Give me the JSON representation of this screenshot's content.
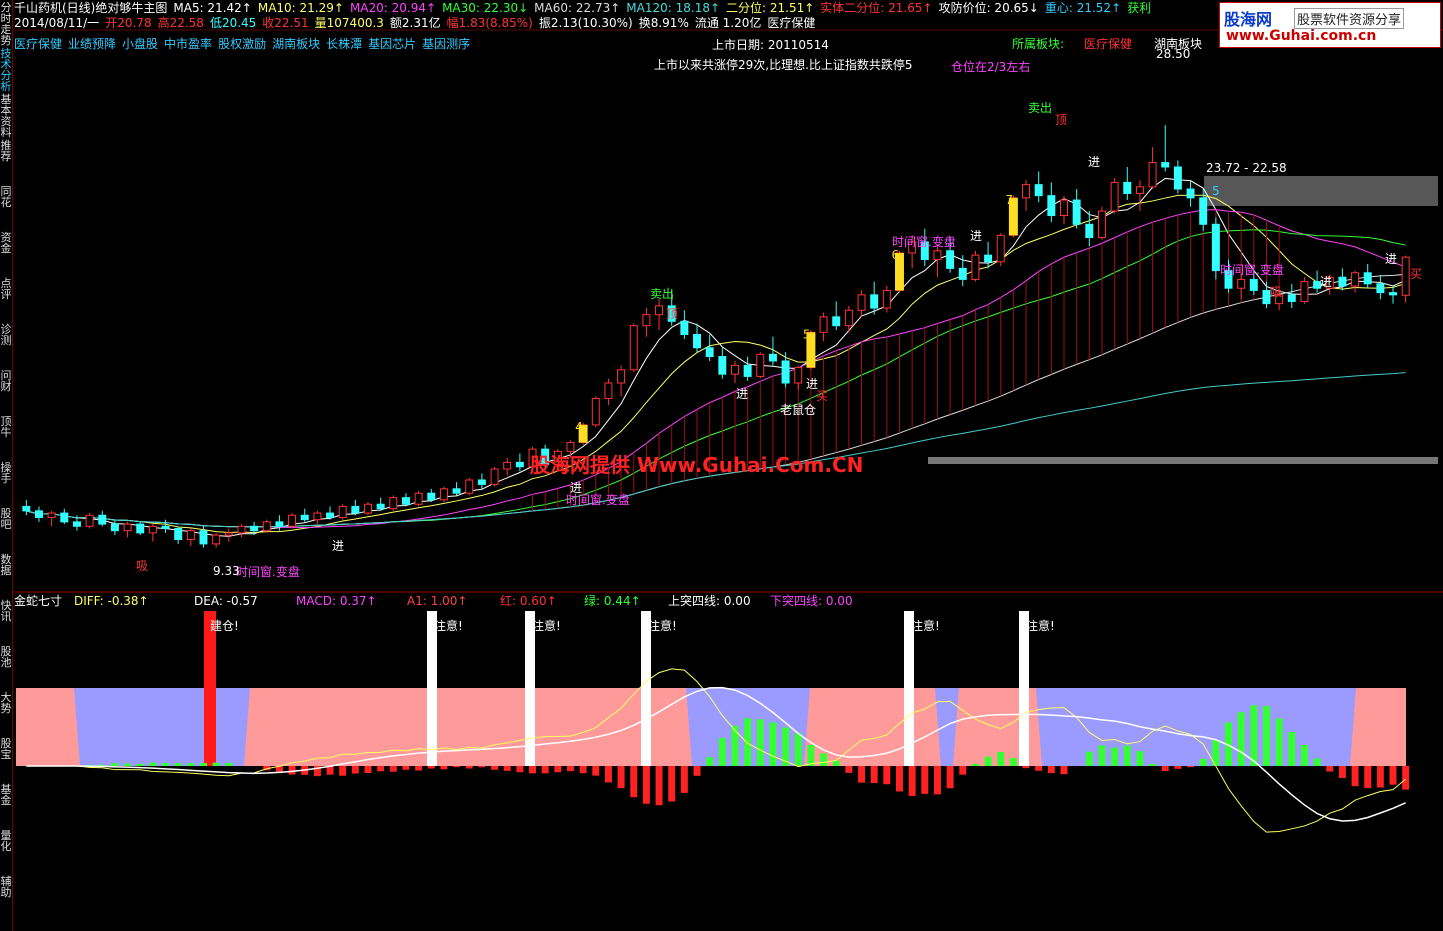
{
  "header": {
    "row1": [
      {
        "t": "千山药机(日线)绝对够牛主图",
        "c": "#ffffff"
      },
      {
        "t": "MA5: 21.42↑",
        "c": "#ffffff"
      },
      {
        "t": "MA10: 21.29↑",
        "c": "#ffff66"
      },
      {
        "t": "MA20: 20.94↑",
        "c": "#ff44ff"
      },
      {
        "t": "MA30: 22.30↓",
        "c": "#33ff33"
      },
      {
        "t": "MA60: 22.73↑",
        "c": "#dddddd"
      },
      {
        "t": "MA120: 18.18↑",
        "c": "#44dddd"
      },
      {
        "t": "二分位: 21.51↑",
        "c": "#ffff66"
      },
      {
        "t": "实体二分位: 21.65↑",
        "c": "#ff3333"
      },
      {
        "t": "攻防价位: 20.65↓",
        "c": "#ffffff"
      },
      {
        "t": "重心: 21.52↑",
        "c": "#33ccff"
      },
      {
        "t": "获利",
        "c": "#33ff33"
      }
    ],
    "row2": [
      {
        "t": "2014/08/11/一",
        "c": "#ffffff"
      },
      {
        "t": "开20.78",
        "c": "#ff3333"
      },
      {
        "t": "高22.58",
        "c": "#ff3333"
      },
      {
        "t": "低20.45",
        "c": "#33ffff"
      },
      {
        "t": "收22.51",
        "c": "#ff3333"
      },
      {
        "t": "量107400.3",
        "c": "#ffff66"
      },
      {
        "t": "额2.31亿",
        "c": "#ffffff"
      },
      {
        "t": "幅1.83(8.85%)",
        "c": "#ff3333"
      },
      {
        "t": "振2.13(10.30%)",
        "c": "#ffffff"
      },
      {
        "t": "换8.91%",
        "c": "#ffffff"
      },
      {
        "t": "流通 1.20亿",
        "c": "#ffffff"
      },
      {
        "t": "医疗保健",
        "c": "#ffffff"
      }
    ],
    "row3": [
      {
        "t": "医疗保健",
        "c": "#33ccff"
      },
      {
        "t": "业绩预降",
        "c": "#33ccff"
      },
      {
        "t": "小盘股",
        "c": "#33ccff"
      },
      {
        "t": "中市盈率",
        "c": "#33ccff"
      },
      {
        "t": "股权激励",
        "c": "#33ccff"
      },
      {
        "t": "湖南板块",
        "c": "#33ccff"
      },
      {
        "t": "长株潭",
        "c": "#33ccff"
      },
      {
        "t": "基因芯片",
        "c": "#33ccff"
      },
      {
        "t": "基因测序",
        "c": "#33ccff"
      }
    ]
  },
  "sidebar": {
    "items": [
      "分时走势",
      "技术分析",
      "基本资料",
      "推荐",
      "同花",
      "资金",
      "点评",
      "诊测",
      "问财",
      "顶牛",
      "操手",
      "股吧",
      "数据",
      "快讯",
      "股池",
      "大势",
      "股宝",
      "基金",
      "量化",
      "辅助"
    ]
  },
  "logo": {
    "name": "股海网",
    "sub": "股票软件资源分享",
    "url": "www.Guhai.com.cn"
  },
  "annotations": {
    "listing_date": "上市日期: 20110514",
    "listing_summary": "上市以来共涨停29次,比理想.比上证指数共跌停5",
    "position_hint": "仓位在2/3左右",
    "sector_label": "所属板块:",
    "sector_value": "医疗保健",
    "sector_value2": "湖南板块",
    "peak": "28.50",
    "range": "23.72 - 22.58",
    "low": "9.33",
    "box_num": "5",
    "watermark": "股海网提供 Www.Guhai.Com.CN"
  },
  "chart_data": {
    "type": "candlestick",
    "n": 110,
    "ohlc": [
      [
        11.2,
        11.5,
        10.8,
        11.0
      ],
      [
        11.0,
        11.2,
        10.5,
        10.7
      ],
      [
        10.7,
        11.0,
        10.3,
        10.9
      ],
      [
        10.9,
        11.1,
        10.4,
        10.5
      ],
      [
        10.5,
        10.8,
        10.1,
        10.3
      ],
      [
        10.3,
        10.9,
        10.2,
        10.8
      ],
      [
        10.8,
        11.0,
        10.3,
        10.4
      ],
      [
        10.4,
        10.6,
        9.9,
        10.1
      ],
      [
        10.1,
        10.5,
        9.8,
        10.4
      ],
      [
        10.4,
        10.5,
        9.9,
        10.0
      ],
      [
        10.0,
        10.4,
        9.6,
        10.3
      ],
      [
        10.3,
        10.6,
        10.0,
        10.2
      ],
      [
        10.2,
        10.3,
        9.5,
        9.7
      ],
      [
        9.7,
        10.2,
        9.4,
        10.1
      ],
      [
        10.1,
        10.3,
        9.33,
        9.5
      ],
      [
        9.5,
        10.0,
        9.33,
        9.9
      ],
      [
        9.9,
        10.2,
        9.6,
        10.0
      ],
      [
        10.0,
        10.4,
        9.8,
        10.3
      ],
      [
        10.3,
        10.5,
        9.9,
        10.1
      ],
      [
        10.1,
        10.6,
        10.0,
        10.5
      ],
      [
        10.5,
        10.8,
        10.1,
        10.3
      ],
      [
        10.3,
        10.9,
        10.2,
        10.8
      ],
      [
        10.8,
        11.1,
        10.5,
        10.6
      ],
      [
        10.6,
        11.0,
        10.4,
        10.9
      ],
      [
        10.9,
        11.2,
        10.6,
        10.7
      ],
      [
        10.7,
        11.3,
        10.6,
        11.2
      ],
      [
        11.2,
        11.5,
        10.8,
        10.9
      ],
      [
        10.9,
        11.4,
        10.8,
        11.3
      ],
      [
        11.3,
        11.6,
        11.0,
        11.1
      ],
      [
        11.1,
        11.7,
        11.0,
        11.6
      ],
      [
        11.6,
        11.8,
        11.2,
        11.3
      ],
      [
        11.3,
        11.9,
        11.2,
        11.8
      ],
      [
        11.8,
        12.0,
        11.4,
        11.5
      ],
      [
        11.5,
        12.1,
        11.4,
        12.0
      ],
      [
        12.0,
        12.3,
        11.7,
        11.8
      ],
      [
        11.8,
        12.5,
        11.7,
        12.4
      ],
      [
        12.4,
        12.7,
        12.0,
        12.2
      ],
      [
        12.2,
        13.0,
        12.1,
        12.9
      ],
      [
        12.9,
        13.4,
        12.6,
        13.2
      ],
      [
        13.2,
        13.6,
        12.8,
        13.0
      ],
      [
        13.0,
        13.9,
        12.9,
        13.8
      ],
      [
        13.8,
        14.0,
        12.9,
        13.1
      ],
      [
        13.1,
        13.8,
        13.0,
        13.7
      ],
      [
        13.7,
        14.2,
        13.4,
        14.1
      ],
      [
        14.1,
        15.0,
        14.0,
        14.9
      ],
      [
        14.9,
        16.2,
        14.8,
        16.1
      ],
      [
        16.1,
        17.0,
        15.8,
        16.8
      ],
      [
        16.8,
        17.6,
        16.2,
        17.4
      ],
      [
        17.4,
        19.5,
        17.3,
        19.4
      ],
      [
        19.4,
        20.2,
        18.9,
        19.9
      ],
      [
        19.9,
        20.6,
        19.2,
        20.3
      ],
      [
        20.3,
        21.0,
        19.4,
        19.6
      ],
      [
        19.6,
        20.1,
        18.8,
        19.0
      ],
      [
        19.0,
        19.5,
        18.2,
        18.4
      ],
      [
        18.4,
        19.0,
        17.8,
        18.0
      ],
      [
        18.0,
        18.4,
        17.0,
        17.2
      ],
      [
        17.2,
        17.8,
        16.8,
        17.6
      ],
      [
        17.6,
        18.0,
        16.9,
        17.1
      ],
      [
        17.1,
        18.2,
        17.0,
        18.1
      ],
      [
        18.1,
        18.9,
        17.6,
        17.8
      ],
      [
        17.8,
        18.2,
        16.6,
        16.8
      ],
      [
        16.8,
        17.6,
        16.5,
        17.5
      ],
      [
        17.5,
        19.2,
        17.4,
        19.1
      ],
      [
        19.1,
        20.0,
        18.7,
        19.8
      ],
      [
        19.8,
        20.5,
        19.2,
        19.4
      ],
      [
        19.4,
        20.3,
        19.1,
        20.1
      ],
      [
        20.1,
        21.0,
        19.8,
        20.8
      ],
      [
        20.8,
        21.4,
        19.9,
        20.2
      ],
      [
        20.2,
        21.2,
        20.0,
        21.0
      ],
      [
        21.0,
        22.8,
        20.9,
        22.7
      ],
      [
        22.7,
        23.5,
        22.0,
        23.2
      ],
      [
        23.2,
        23.8,
        22.1,
        22.4
      ],
      [
        22.4,
        23.0,
        21.6,
        22.8
      ],
      [
        22.8,
        23.4,
        21.8,
        22.0
      ],
      [
        22.0,
        22.6,
        21.2,
        21.5
      ],
      [
        21.5,
        22.8,
        21.4,
        22.6
      ],
      [
        22.6,
        23.2,
        22.0,
        22.3
      ],
      [
        22.3,
        23.6,
        22.1,
        23.5
      ],
      [
        23.5,
        25.3,
        23.4,
        25.2
      ],
      [
        25.2,
        26.0,
        24.6,
        25.8
      ],
      [
        25.8,
        26.4,
        25.0,
        25.3
      ],
      [
        25.3,
        25.9,
        24.1,
        24.4
      ],
      [
        24.4,
        25.3,
        24.0,
        25.1
      ],
      [
        25.1,
        25.6,
        23.8,
        24.0
      ],
      [
        24.0,
        24.6,
        23.0,
        23.4
      ],
      [
        23.4,
        24.8,
        23.3,
        24.6
      ],
      [
        24.6,
        26.1,
        24.5,
        25.9
      ],
      [
        25.9,
        26.6,
        25.1,
        25.4
      ],
      [
        25.4,
        26.0,
        24.6,
        25.7
      ],
      [
        25.7,
        27.5,
        25.6,
        26.8
      ],
      [
        26.8,
        28.5,
        26.4,
        26.6
      ],
      [
        26.6,
        26.9,
        25.4,
        25.6
      ],
      [
        25.6,
        26.0,
        24.8,
        25.2
      ],
      [
        25.2,
        25.6,
        23.7,
        24.0
      ],
      [
        24.0,
        24.3,
        21.5,
        21.9
      ],
      [
        21.9,
        22.4,
        20.9,
        21.1
      ],
      [
        21.1,
        21.8,
        20.6,
        21.5
      ],
      [
        21.5,
        21.9,
        20.8,
        21.0
      ],
      [
        21.0,
        21.4,
        20.2,
        20.4
      ],
      [
        20.4,
        21.0,
        20.1,
        20.8
      ],
      [
        20.8,
        21.3,
        20.2,
        20.5
      ],
      [
        20.5,
        21.6,
        20.4,
        21.4
      ],
      [
        21.4,
        21.9,
        20.9,
        21.1
      ],
      [
        21.1,
        21.7,
        20.8,
        21.6
      ],
      [
        21.6,
        22.0,
        21.0,
        21.2
      ],
      [
        21.2,
        21.9,
        20.9,
        21.8
      ],
      [
        21.8,
        22.2,
        21.1,
        21.3
      ],
      [
        21.3,
        21.7,
        20.6,
        20.9
      ],
      [
        20.9,
        21.2,
        20.4,
        20.8
      ],
      [
        20.78,
        22.58,
        20.45,
        22.51
      ]
    ],
    "ylim": [
      7.5,
      31
    ],
    "macd_panel": {
      "title": "金蛇七寸",
      "indicators": [
        {
          "t": "DIFF: -0.38↑",
          "c": "#ffff66"
        },
        {
          "t": "DEA: -0.57",
          "c": "#ffffff"
        },
        {
          "t": "MACD: 0.37↑",
          "c": "#ff44ff"
        },
        {
          "t": "A1: 1.00↑",
          "c": "#ff4444"
        },
        {
          "t": "红: 0.60↑",
          "c": "#ff3333"
        },
        {
          "t": "绿: 0.44↑",
          "c": "#33ff33"
        },
        {
          "t": "上突四线: 0.00",
          "c": "#ffffff"
        },
        {
          "t": "下突四线: 0.00",
          "c": "#ff44ff"
        }
      ],
      "notes": [
        "建仓!",
        "注意!",
        "注意!",
        "注意!",
        "注意!",
        "注意!"
      ]
    },
    "labels": {
      "buy": "进",
      "sell": "卖出",
      "top": "顶",
      "absorb": "吸",
      "mouse": "老鼠仓",
      "window": "时间窗.变盘",
      "buy2": "买",
      "nums": [
        "4",
        "5",
        "6",
        "7"
      ]
    },
    "colors": {
      "up": "#ff3333",
      "down": "#33ffff",
      "ma5": "#ffffff",
      "ma10": "#ffff66",
      "ma20": "#ff44ff",
      "ma30": "#33ff33",
      "ma60": "#dddddd",
      "ma120": "#44cccc"
    }
  }
}
